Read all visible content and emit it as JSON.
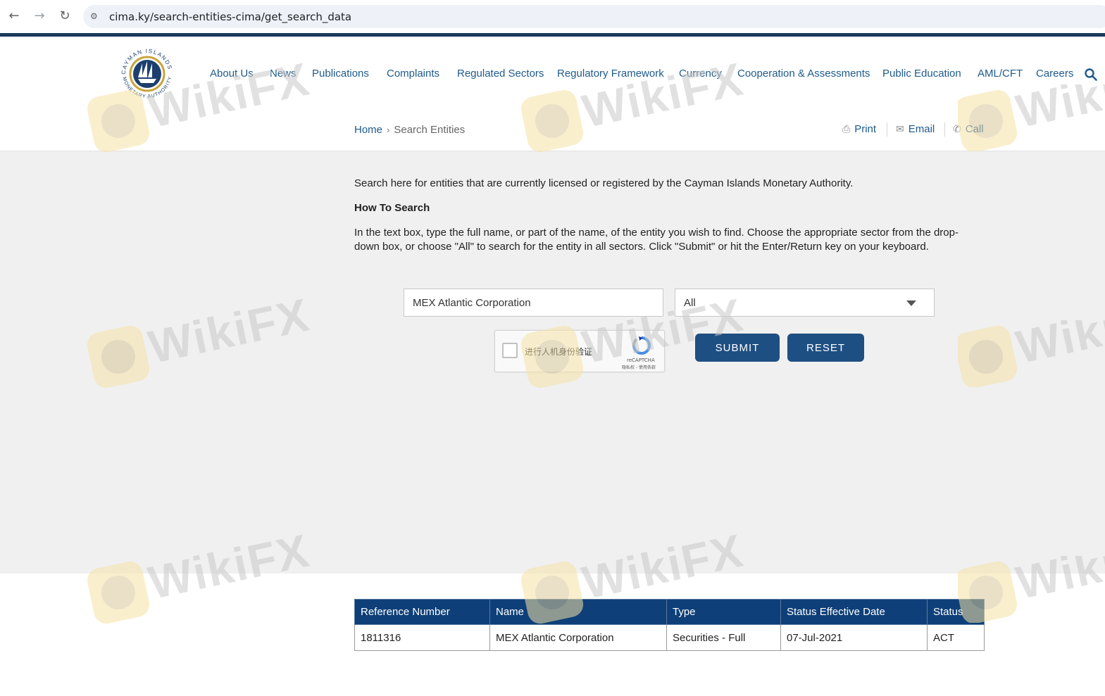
{
  "browser": {
    "url": "cima.ky/search-entities-cima/get_search_data"
  },
  "header": {
    "nav": [
      {
        "label": "About Us"
      },
      {
        "label": "News"
      },
      {
        "label": "Publications"
      },
      {
        "label": "Complaints"
      },
      {
        "label": "Regulated Sectors"
      },
      {
        "label": "Regulatory Framework"
      },
      {
        "label": "Currency"
      },
      {
        "label": "Cooperation & Assessments"
      },
      {
        "label": "Public Education"
      },
      {
        "label": "AML/CFT"
      },
      {
        "label": "Careers"
      }
    ],
    "logo_text_top": "CAYMAN ISLANDS",
    "logo_text_bottom": "MONETARY AUTHORITY"
  },
  "breadcrumb": {
    "home": "Home",
    "current": "Search Entities"
  },
  "tools": {
    "print": "Print",
    "email": "Email",
    "call": "Call"
  },
  "content": {
    "intro": "Search here for entities that are currently licensed or registered by the Cayman Islands Monetary Authority.",
    "howto_title": "How To Search",
    "instructions": "In the text box, type the full name, or part of the name, of the entity you wish to find. Choose the appropriate sector from the drop-down box, or choose \"All\" to search for the entity in all sectors. Click \"Submit\" or hit the Enter/Return key on your keyboard."
  },
  "form": {
    "search_value": "MEX Atlantic Corporation",
    "sector_value": "All",
    "captcha_label": "进行人机身份验证",
    "captcha_brand": "reCAPTCHA",
    "captcha_terms": "隐私权 - 使用条款",
    "submit_label": "SUBMIT",
    "reset_label": "RESET"
  },
  "results": {
    "columns": [
      "Reference Number",
      "Name",
      "Type",
      "Status Effective Date",
      "Status"
    ],
    "rows": [
      [
        "1811316",
        "MEX Atlantic Corporation",
        "Securities - Full",
        "07-Jul-2021",
        "ACT"
      ]
    ]
  },
  "watermark": "WikiFX",
  "colors": {
    "brand_navy": "#0e3f78",
    "link_blue": "#1e5a8c",
    "button_blue": "#1e4f82",
    "panel_gray": "#f0f0f0"
  }
}
